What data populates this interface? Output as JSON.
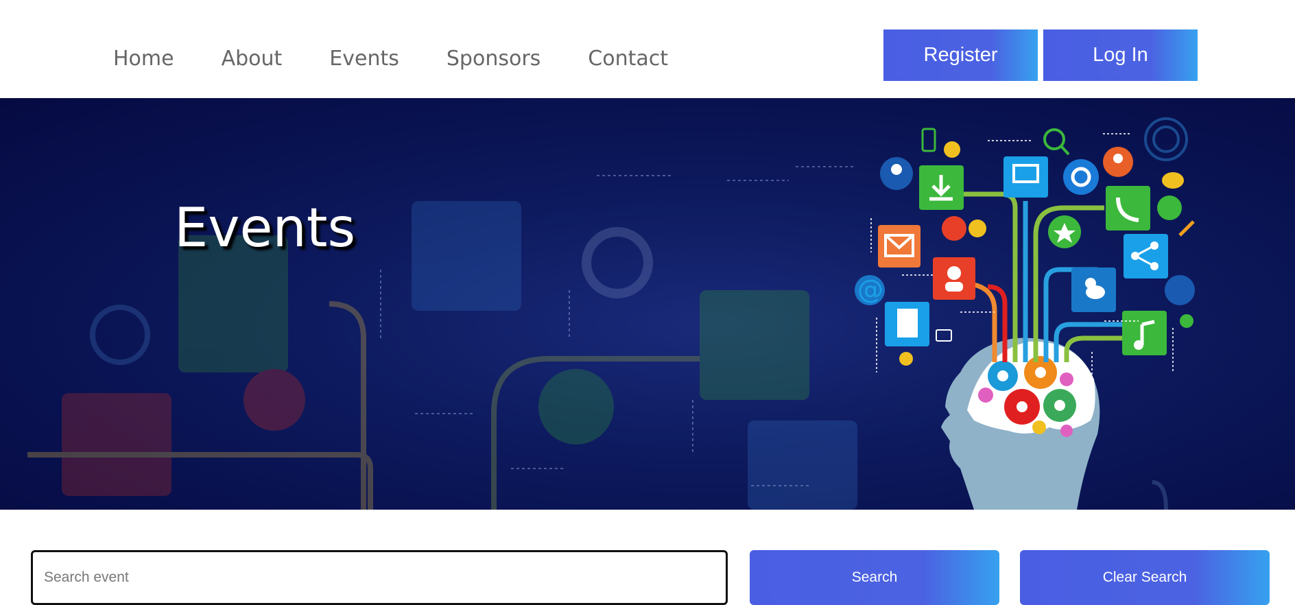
{
  "nav": {
    "links": [
      "Home",
      "About",
      "Events",
      "Sponsors",
      "Contact"
    ],
    "register_label": "Register",
    "login_label": "Log In"
  },
  "hero": {
    "title": "Events",
    "image": "head-with-gears-and-app-icons-illustration"
  },
  "search": {
    "placeholder": "Search event",
    "value": "",
    "search_label": "Search",
    "clear_label": "Clear Search"
  },
  "colors": {
    "button_gradient_start": "#4a5ee3",
    "button_gradient_end": "#37a1ef",
    "hero_background": "#050a42",
    "nav_text": "#666666"
  }
}
